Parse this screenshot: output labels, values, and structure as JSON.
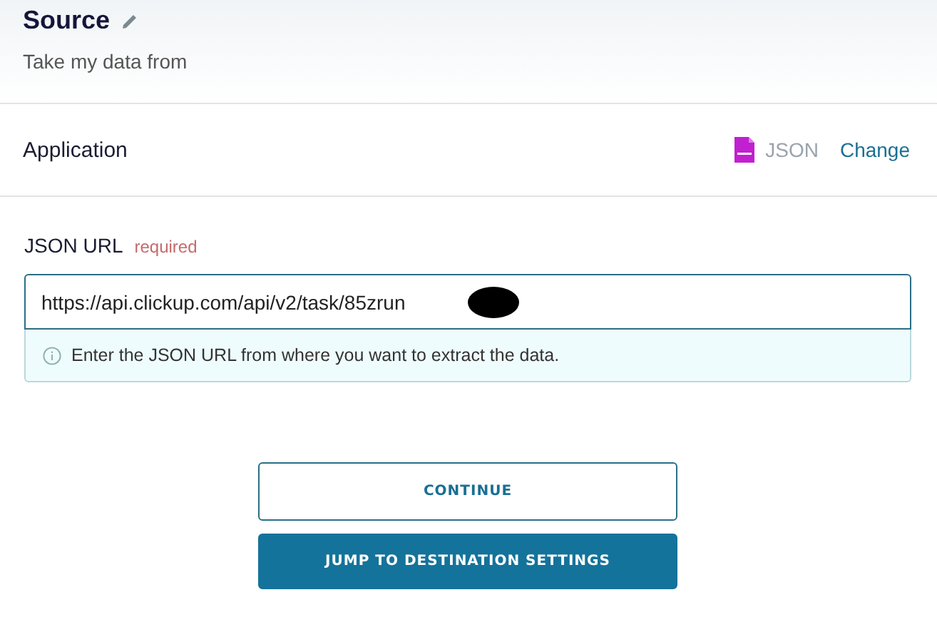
{
  "header": {
    "title": "Source",
    "subtitle": "Take my data from"
  },
  "application": {
    "label": "Application",
    "app_name": "JSON",
    "change_link": "Change"
  },
  "field": {
    "label": "JSON URL",
    "badge": "required",
    "value": "https://api.clickup.com/api/v2/task/85zrun",
    "help": "Enter the JSON URL from where you want to extract the data."
  },
  "buttons": [
    {
      "label": "CONTINUE",
      "kind": "outline"
    },
    {
      "label": "JUMP TO DESTINATION SETTINGS",
      "kind": "primary"
    }
  ]
}
